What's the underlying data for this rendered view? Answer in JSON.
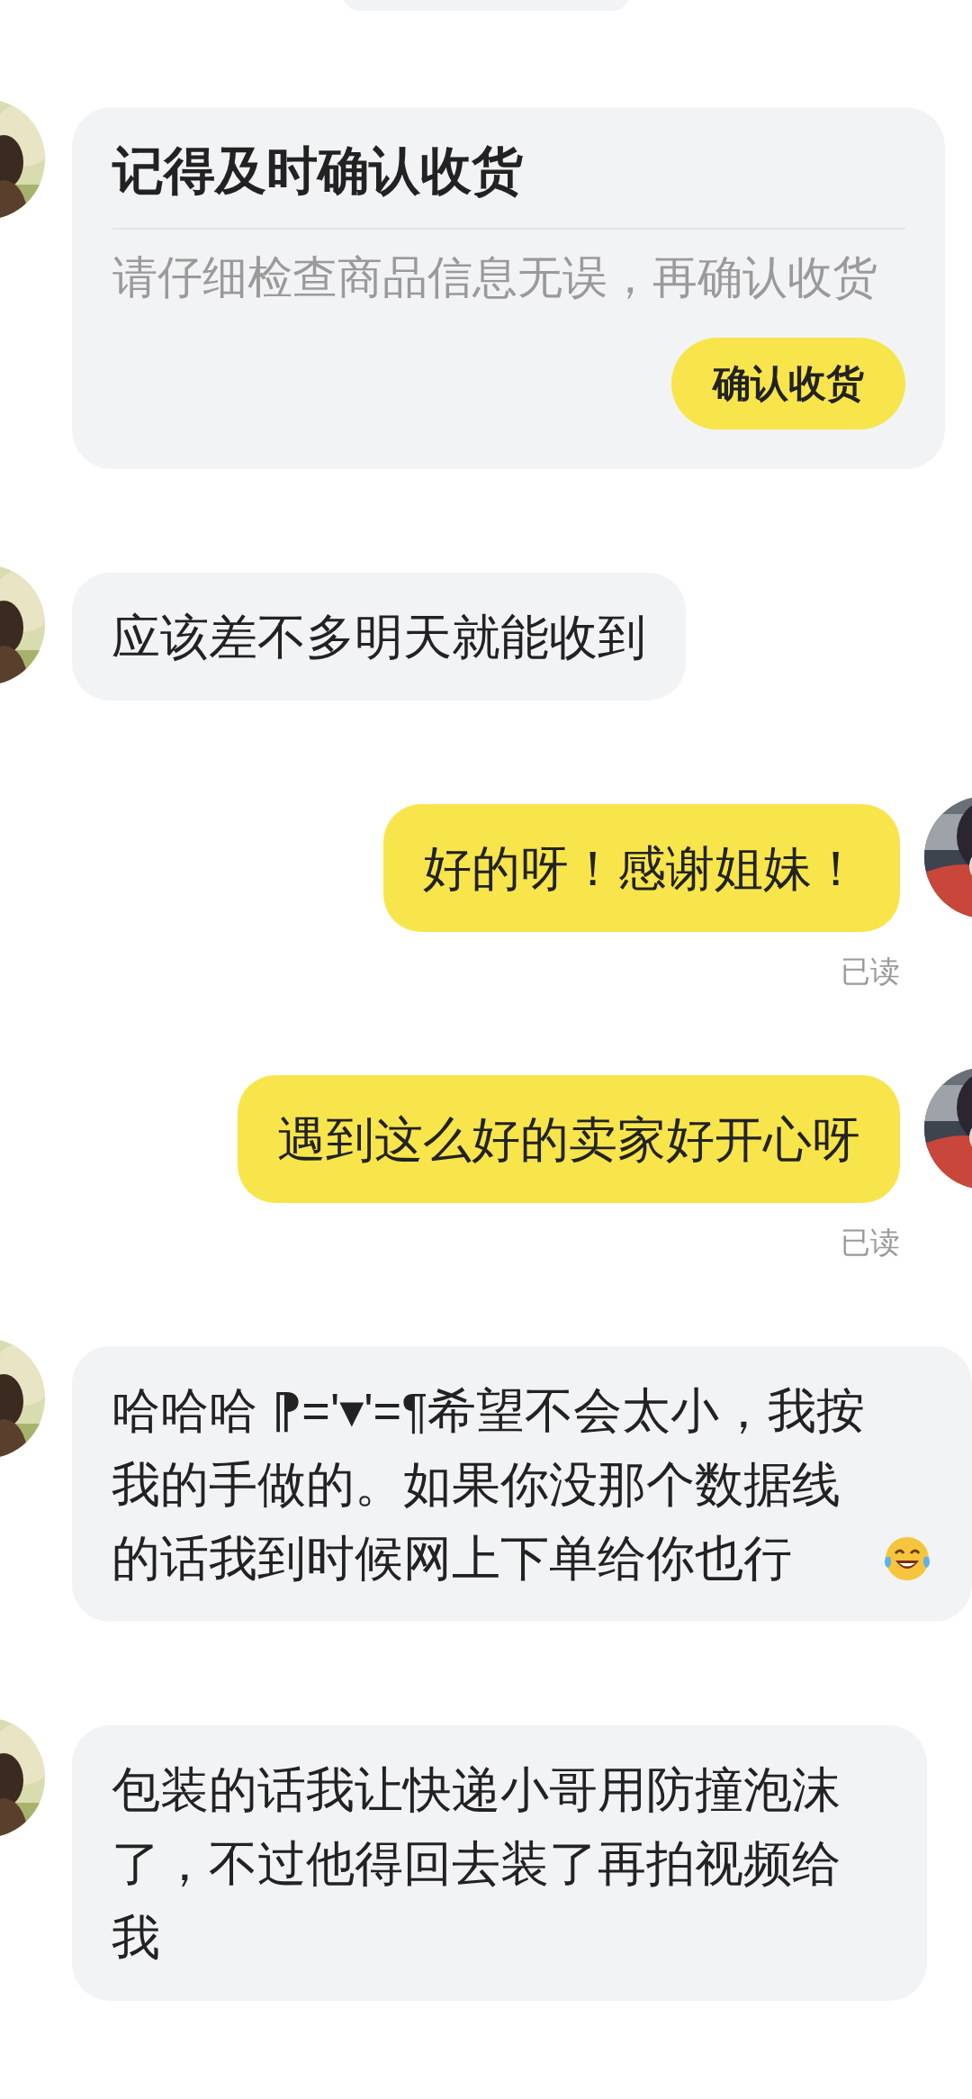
{
  "messages": [
    {
      "kind": "card",
      "outgoing": false,
      "title": "记得及时确认收货",
      "body": "请仔细检查商品信息无误，再确认收货",
      "button": "确认收货"
    },
    {
      "kind": "text",
      "outgoing": false,
      "text": "应该差不多明天就能收到"
    },
    {
      "kind": "text",
      "outgoing": true,
      "text": "好的呀！感谢姐妹！",
      "status": "已读"
    },
    {
      "kind": "text",
      "outgoing": true,
      "text": "遇到这么好的卖家好开心呀",
      "status": "已读"
    },
    {
      "kind": "text",
      "outgoing": false,
      "text": "哈哈哈 ⁋='▾'=¶希望不会太小，我按我的手做的。如果你没那个数据线的话我到时候网上下单给你也行",
      "laughing_emoji": true
    },
    {
      "kind": "text",
      "outgoing": false,
      "text": "包装的话我让快递小哥用防撞泡沫了，不过他得回去装了再拍视频给我"
    }
  ]
}
